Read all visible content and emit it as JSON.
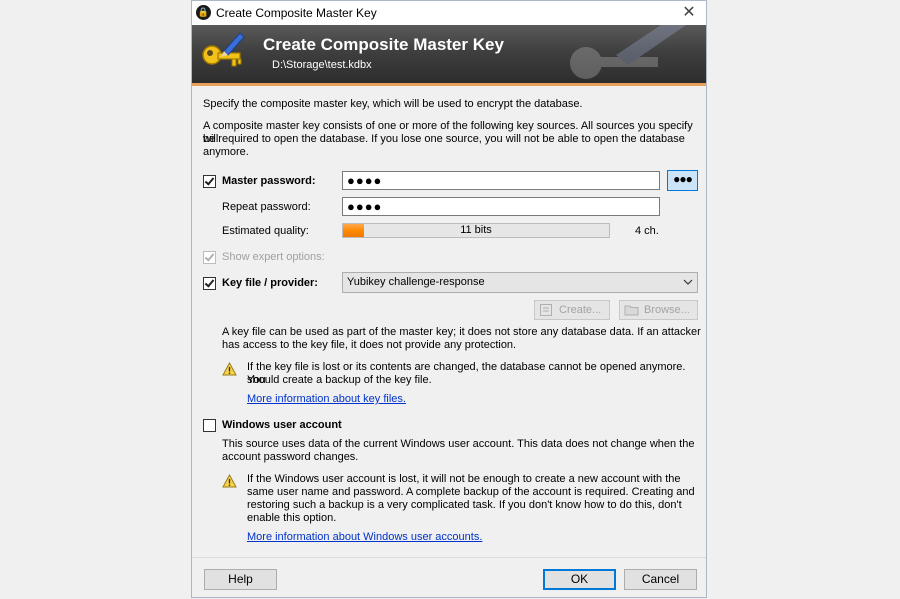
{
  "window": {
    "title": "Create Composite Master Key",
    "close_glyph": "✕"
  },
  "banner": {
    "title": "Create Composite Master Key",
    "subtitle": "D:\\Storage\\test.kdbx",
    "icon": "key-pencil-icon"
  },
  "intro": {
    "line1": "Specify the composite master key, which will be used to encrypt the database.",
    "line2a": "A composite master key consists of one or more of the following key sources. All sources you specify will",
    "line2b": "be required to open the database. If you lose one source, you will not be able to open the database",
    "line2c": "anymore."
  },
  "master_password": {
    "label": "Master password:",
    "checked": true,
    "value": "●●●●",
    "reveal_button": "●●●",
    "repeat_label": "Repeat password:",
    "repeat_value": "●●●●",
    "quality_label": "Estimated quality:",
    "quality_text": "11 bits",
    "quality_fraction": 0.08,
    "length_text": "4 ch."
  },
  "expert": {
    "label": "Show expert options:",
    "checked": true,
    "disabled": true
  },
  "key_file": {
    "label": "Key file / provider:",
    "checked": true,
    "selected": "Yubikey challenge-response",
    "create_button": "Create...",
    "browse_button": "Browse...",
    "info_a": "A key file can be used as part of the master key; it does not store any database data. If an attacker",
    "info_b": "has access to the key file, it does not provide any protection.",
    "warn_a": "If the key file is lost or its contents are changed, the database cannot be opened anymore. You",
    "warn_b": "should create a backup of the key file.",
    "link": "More information about key files."
  },
  "windows_account": {
    "label": "Windows user account",
    "checked": false,
    "info_a": "This source uses data of the current Windows user account. This data does not change when the",
    "info_b": "account password changes.",
    "warn_a": "If the Windows user account is lost, it will not be enough to create a new account with the",
    "warn_b": "same user name and password. A complete backup of the account is required. Creating and",
    "warn_c": "restoring such a backup is a very complicated task. If you don't know how to do this, don't",
    "warn_d": "enable this option.",
    "link": "More information about Windows user accounts."
  },
  "footer": {
    "help": "Help",
    "ok": "OK",
    "cancel": "Cancel"
  },
  "colors": {
    "accent": "#0078d7",
    "quality_fill": "#ff8a00",
    "link": "#0033cc",
    "banner_line": "#e8a05a"
  }
}
